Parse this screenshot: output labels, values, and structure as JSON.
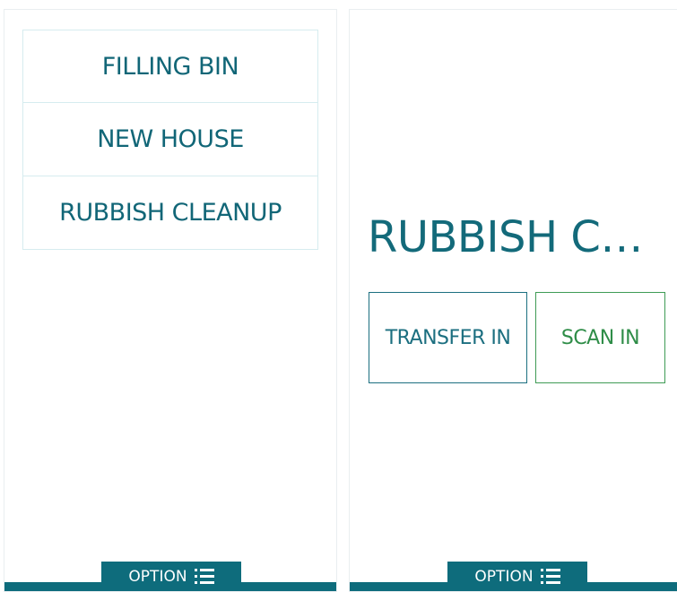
{
  "left_screen": {
    "menu_items": [
      {
        "label": "FILLING BIN"
      },
      {
        "label": "NEW HOUSE"
      },
      {
        "label": "RUBBISH CLEANUP"
      }
    ],
    "option_label": "OPTION",
    "option_icon": "list-menu-icon"
  },
  "right_screen": {
    "title": "RUBBISH C…",
    "transfer_in_label": "TRANSFER IN",
    "scan_in_label": "SCAN IN",
    "option_label": "OPTION",
    "option_icon": "list-menu-icon"
  },
  "colors": {
    "primary": "#0e6c7c",
    "text_teal": "#116677",
    "scan_green": "#2f8d48",
    "divider": "#d6ecef"
  }
}
